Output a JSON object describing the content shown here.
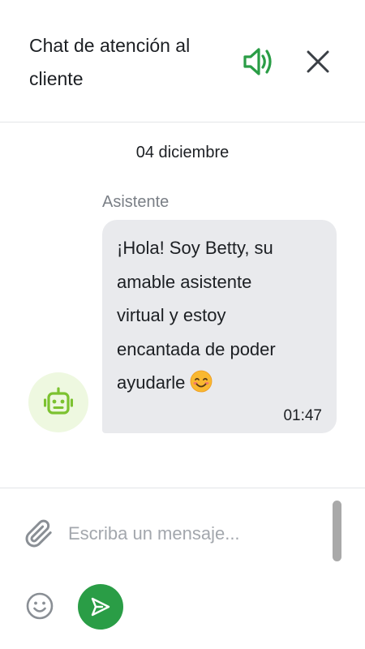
{
  "header": {
    "title_line1": "Chat de atención al",
    "title_line2": "cliente",
    "sound_icon": "speaker-volume-icon",
    "close_icon": "close-icon"
  },
  "conversation": {
    "date": "04 diciembre",
    "messages": [
      {
        "sender": "Asistente",
        "lines": [
          "¡Hola! Soy Betty, su",
          "amable asistente",
          "virtual y estoy",
          "encantada de poder",
          "ayudarle"
        ],
        "emoji": "smiling-face-with-smiling-eyes",
        "time": "01:47",
        "avatar_icon": "robot-icon"
      }
    ]
  },
  "composer": {
    "placeholder": "Escriba un mensaje...",
    "value": "",
    "attach_icon": "paperclip-icon",
    "emoji_icon": "smiley-icon",
    "send_icon": "send-icon"
  },
  "colors": {
    "accent": "#2a9d46",
    "bubble_bg": "#e9eaed",
    "avatar_bg": "#eef8e0",
    "robot": "#7cc230",
    "icon_gray": "#8a8f95"
  }
}
